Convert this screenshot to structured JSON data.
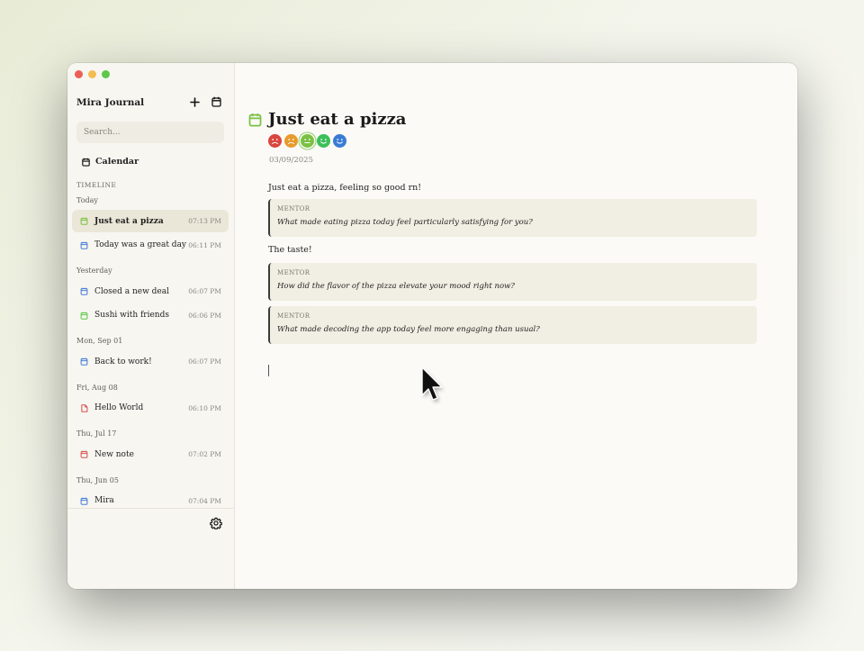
{
  "window": {
    "app_title": "Mira Journal"
  },
  "search": {
    "placeholder": "Search..."
  },
  "sidebar": {
    "calendar_label": "Calendar",
    "timeline_heading": "TIMELINE",
    "groups": [
      {
        "label": "Today",
        "entries": [
          {
            "title": "Just eat a pizza",
            "time": "07:13 PM",
            "icon": "calendar-icon",
            "color": "#7ac143",
            "active": true
          },
          {
            "title": "Today was a great day",
            "time": "06:11 PM",
            "icon": "calendar-icon",
            "color": "#4a7fd4"
          }
        ]
      },
      {
        "label": "Yesterday",
        "entries": [
          {
            "title": "Closed a new deal",
            "time": "06:07 PM",
            "icon": "calendar-icon",
            "color": "#4a7fd4"
          },
          {
            "title": "Sushi with friends",
            "time": "06:06 PM",
            "icon": "calendar-icon",
            "color": "#5ec748"
          }
        ]
      },
      {
        "label": "Mon, Sep 01",
        "entries": [
          {
            "title": "Back to work!",
            "time": "06:07 PM",
            "icon": "calendar-icon",
            "color": "#4a7fd4"
          }
        ]
      },
      {
        "label": "Fri, Aug 08",
        "entries": [
          {
            "title": "Hello World",
            "time": "06:10 PM",
            "icon": "document-icon",
            "color": "#d9534f"
          }
        ]
      },
      {
        "label": "Thu, Jul 17",
        "entries": [
          {
            "title": "New note",
            "time": "07:02 PM",
            "icon": "calendar-icon",
            "color": "#d9534f"
          }
        ]
      },
      {
        "label": "Thu, Jun 05",
        "entries": [
          {
            "title": "Mira",
            "time": "07:04 PM",
            "icon": "calendar-icon",
            "color": "#4a7fd4"
          }
        ]
      }
    ]
  },
  "entry": {
    "title": "Just eat a pizza",
    "title_icon_color": "#7ac143",
    "date": "03/09/2025",
    "moods": [
      {
        "name": "very-sad-mood-icon",
        "color": "#d9463f"
      },
      {
        "name": "sad-mood-icon",
        "color": "#e89a2c"
      },
      {
        "name": "neutral-mood-icon",
        "color": "#7ac143",
        "selected": true
      },
      {
        "name": "happy-mood-icon",
        "color": "#3cbf5a"
      },
      {
        "name": "very-happy-mood-icon",
        "color": "#3a7bd5"
      }
    ],
    "paragraph_1": "Just eat a pizza, feeling so good rn!",
    "mentor_1": {
      "label": "MENTOR",
      "question": "What made eating pizza today feel particularly satisfying for you?"
    },
    "paragraph_2": "The taste!",
    "mentor_2": {
      "label": "MENTOR",
      "question": "How did the flavor of the pizza elevate your mood right now?"
    },
    "mentor_3": {
      "label": "MENTOR",
      "question": "What made decoding the app today feel more engaging than usual?"
    }
  }
}
